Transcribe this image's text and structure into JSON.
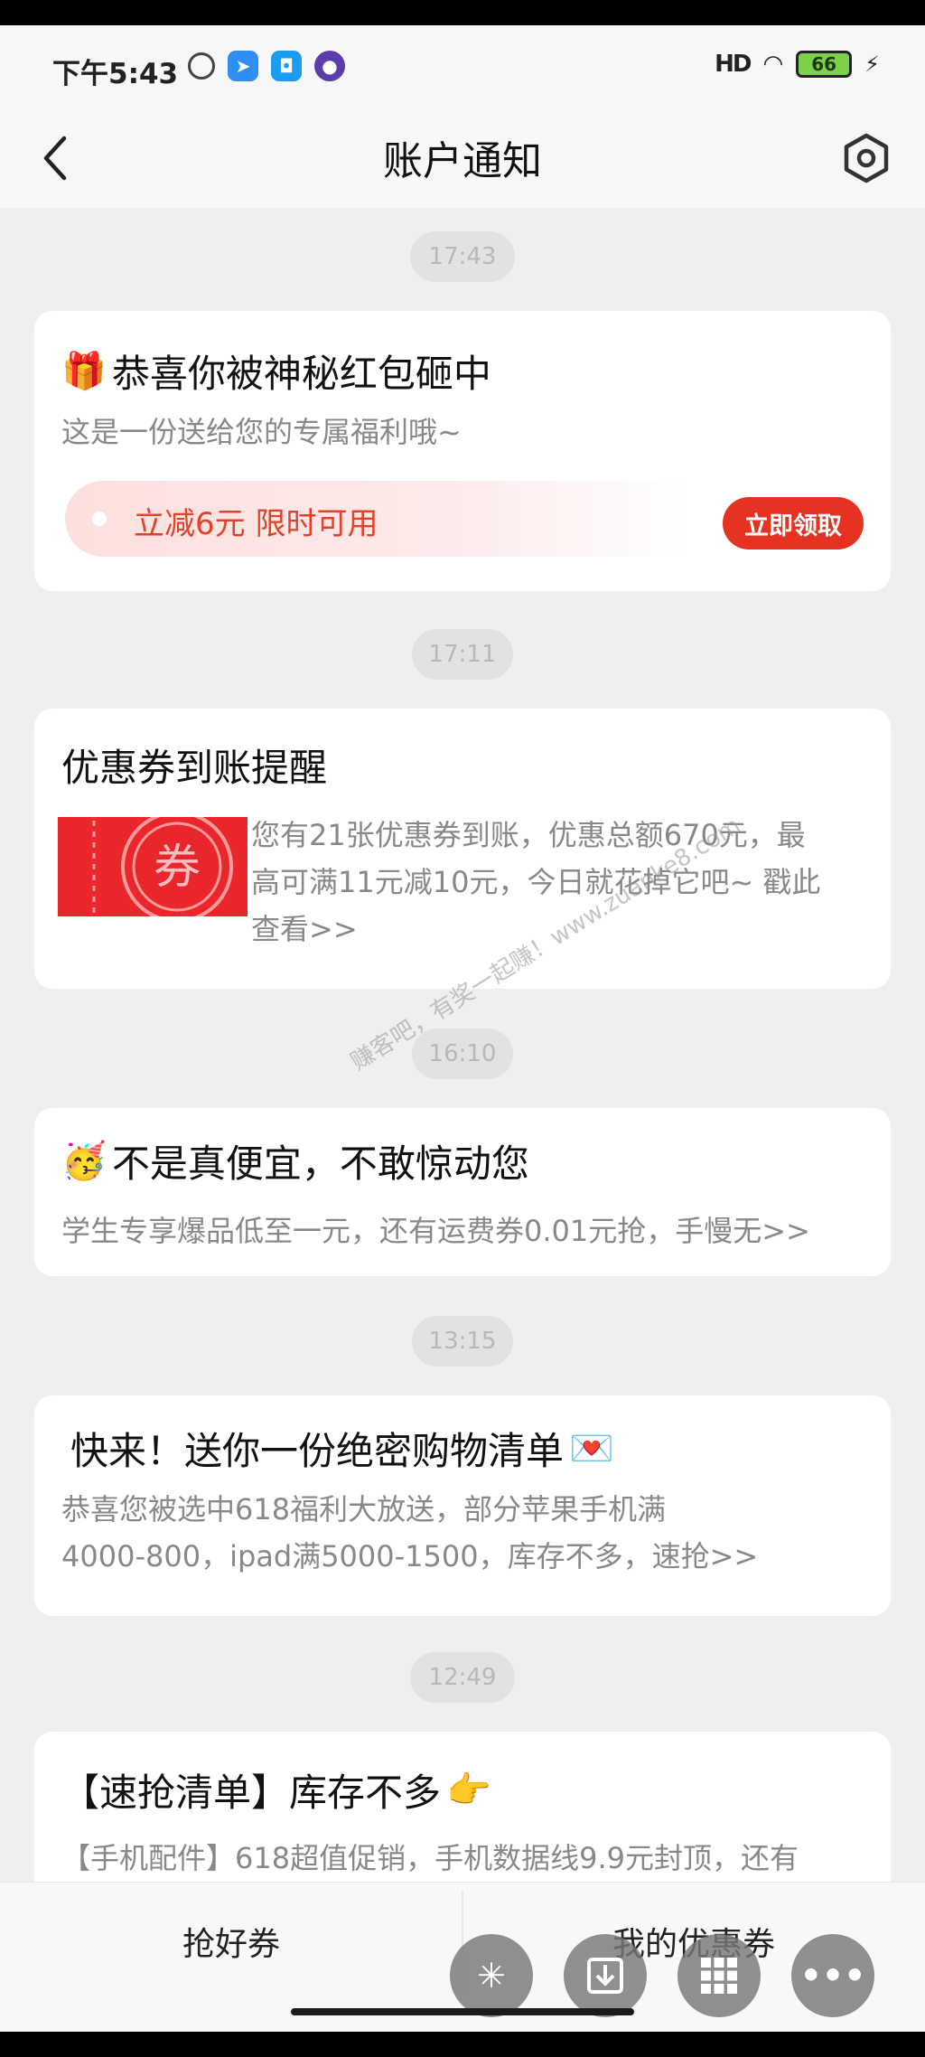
{
  "status": {
    "time": "下午5:43",
    "battery": "66",
    "signal": "HD"
  },
  "nav": {
    "title": "账户通知"
  },
  "messages": [
    {
      "time": "17:43",
      "title_icon": "gift-emoji",
      "title": "恭喜你被神秘红包砸中",
      "desc": "这是一份送给您的专属福利哦~",
      "promo_text": "立减6元 限时可用",
      "button": "立即领取"
    },
    {
      "time": "17:11",
      "title": "优惠券到账提醒",
      "coupon_char": "券",
      "desc_lines": [
        "您有21张优惠券到账，优惠总额670元，最",
        "高可满11元减10元，今日就花掉它吧~ 戳此",
        "查看>>"
      ]
    },
    {
      "time": "16:10",
      "title_icon": "party-face-emoji",
      "title": "不是真便宜，不敢惊动您",
      "desc": "学生专享爆品低至一元，还有运费券0.01元抢，手慢无>>"
    },
    {
      "time": "13:15",
      "title": "快来！送你一份绝密购物清单",
      "title_icon": "love-letter-emoji",
      "desc_lines": [
        "恭喜您被选中618福利大放送，部分苹果手机满",
        "4000-800，ipad满5000-1500，库存不多，速抢>>"
      ]
    },
    {
      "time": "12:49",
      "title": "【速抢清单】库存不多",
      "title_icon": "pointing-hand-emoji",
      "desc": "【手机配件】618超值促销，手机数据线9.9元封顶，还有"
    }
  ],
  "watermark": "赚客吧，有奖一起赚！www.zuanke8.com",
  "tabs": {
    "left": "抢好券",
    "right": "我的优惠券"
  },
  "colors": {
    "accent": "#e63220",
    "promo_text": "#e0422a",
    "background": "#efefef"
  }
}
